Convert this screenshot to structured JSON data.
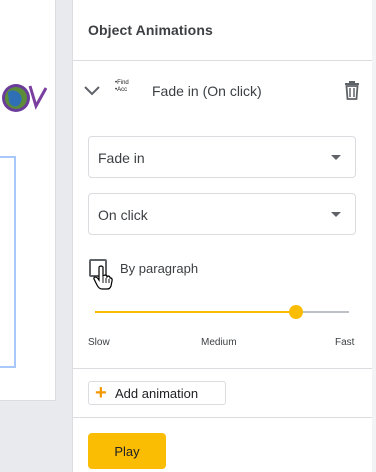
{
  "panel": {
    "title": "Object Animations"
  },
  "animation_item": {
    "thumbnail_lines": [
      "•Find",
      "•Acc"
    ],
    "name": "Fade in  (On click)"
  },
  "effect_select": {
    "value": "Fade in"
  },
  "trigger_select": {
    "value": "On click"
  },
  "by_paragraph": {
    "label": "By paragraph",
    "checked": false
  },
  "speed": {
    "labels": {
      "slow": "Slow",
      "medium": "Medium",
      "fast": "Fast"
    },
    "value_fraction": 0.79
  },
  "add_animation": {
    "label": "Add animation"
  },
  "play": {
    "label": "Play"
  },
  "colors": {
    "accent": "#fbbc04",
    "plus": "#f29900",
    "selection": "#a8c7fa"
  }
}
